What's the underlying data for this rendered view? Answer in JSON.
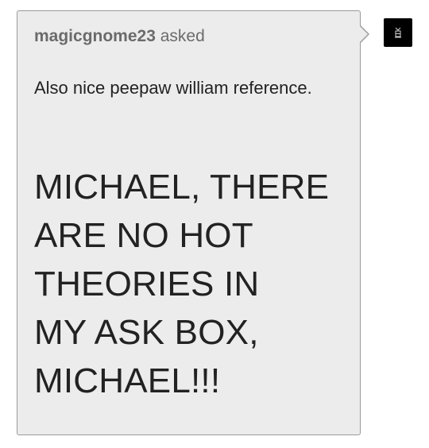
{
  "ask": {
    "asker_name": "magicgnome23",
    "asked_word": "asked",
    "small_text": "Also nice peepaw william reference.",
    "big_lines": [
      "MICHAEL, THERE",
      "ARE NO HOT",
      "THEORIES IN",
      "MY ASK BOX,",
      "MICHAEL!!!"
    ]
  },
  "avatar": {
    "icon": "avatar-icon"
  },
  "colors": {
    "card_bg": "#ececec",
    "card_border": "#9a9a9a",
    "asker_text": "#6b6b6b",
    "body_text": "#222222",
    "avatar_bg": "#000000"
  }
}
